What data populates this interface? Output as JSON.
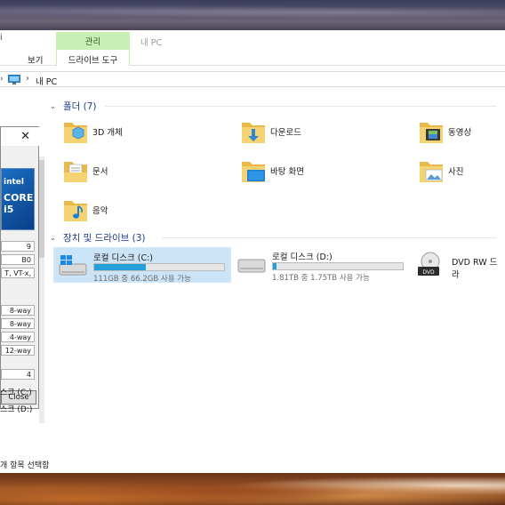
{
  "ribbon": {
    "left_edge": "i",
    "manage_tab": "관리",
    "window_title": "내 PC",
    "view_tab": "보기",
    "drive_tools_tab": "드라이브 도구"
  },
  "address": {
    "path_location": "내 PC"
  },
  "groups": {
    "folders_header": "폴더 (7)",
    "devices_header": "장치 및 드라이브 (3)"
  },
  "folders": [
    {
      "label": "3D 개체",
      "icon": "3d-objects-folder-icon"
    },
    {
      "label": "다운로드",
      "icon": "downloads-folder-icon"
    },
    {
      "label": "동영상",
      "icon": "videos-folder-icon"
    },
    {
      "label": "문서",
      "icon": "documents-folder-icon"
    },
    {
      "label": "바탕 화면",
      "icon": "desktop-folder-icon"
    },
    {
      "label": "사진",
      "icon": "pictures-folder-icon"
    },
    {
      "label": "음악",
      "icon": "music-folder-icon"
    }
  ],
  "drives": [
    {
      "name": "로컬 디스크 (C:)",
      "sub": "111GB 중 66.2GB 사용 가능",
      "used_fraction": 0.4
    },
    {
      "name": "로컬 디스크 (D:)",
      "sub": "1.81TB 중 1.75TB 사용 가능",
      "used_fraction": 0.03
    },
    {
      "name": "DVD RW 드라",
      "sub": ""
    }
  ],
  "cpuz": {
    "close_glyph": "✕",
    "logo_text": "intel",
    "logo_model": "CORE i5",
    "cells": [
      "9",
      "B0",
      "T, VT-x,",
      "8-way",
      "8-way",
      "4-way",
      "12-way",
      "4"
    ],
    "close_button": "Close"
  },
  "sidebar": {
    "drive_c": "스크 (C:)",
    "drive_d": "스크 (D:)"
  },
  "status_bar": {
    "text": "개 항목 선택함"
  },
  "colors": {
    "manage_tab_bg": "#c9f0b4",
    "selection_bg": "#cce4f7",
    "drive_bar_fill": "#26a0da",
    "group_header": "#1e3a8a"
  }
}
